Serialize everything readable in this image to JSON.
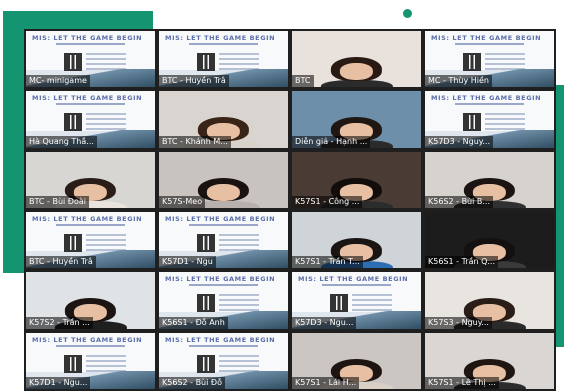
{
  "slide_title": "MIS: LET THE GAME BEGIN",
  "colors": {
    "accent": "#159472",
    "active_speaker": "#9ad24a"
  },
  "participants": [
    {
      "label": "MC- minigame",
      "kind": "slide"
    },
    {
      "label": "BTC - Huyền Trâ",
      "kind": "slide"
    },
    {
      "label": "BTC",
      "kind": "cam",
      "bg": "#e9e1dc",
      "hair": "#2a1a14",
      "body": "#2b2b2b"
    },
    {
      "label": "MC - Thùy Hiền",
      "kind": "slide"
    },
    {
      "label": "Hà Quang Thắ...",
      "kind": "slide"
    },
    {
      "label": "BTC - Khánh M...",
      "kind": "cam",
      "bg": "#d9d4d0",
      "hair": "#3a2418",
      "body": "#d9d2ca"
    },
    {
      "label": "Diễn giả - Hạnh ...",
      "kind": "cam",
      "bg": "#6d8fa9",
      "hair": "#201612",
      "body": "#2b2b2b",
      "speaking": true
    },
    {
      "label": "K57D3 - Nguy...",
      "kind": "slide"
    },
    {
      "label": "BTC - Bùi Đoài",
      "kind": "cam",
      "bg": "#d8d6d2",
      "hair": "#2a1d17",
      "body": "#e8e3dd"
    },
    {
      "label": "K57S-Meo",
      "kind": "cam",
      "bg": "#c9c3bf",
      "hair": "#1a1210",
      "body": "#b8b0ad"
    },
    {
      "label": "K57S1 - Công ...",
      "kind": "cam",
      "bg": "#4a3b34",
      "hair": "#120c0a",
      "body": "#2c2c2c"
    },
    {
      "label": "K56S2 - Bùi B...",
      "kind": "cam",
      "bg": "#d6d3cf",
      "hair": "#1c1412",
      "body": "#303030"
    },
    {
      "label": "BTC - Huyền Trâ",
      "kind": "slide"
    },
    {
      "label": "K57D1 - Ngu",
      "kind": "slide"
    },
    {
      "label": "K57S1 - Trần T...",
      "kind": "cam",
      "bg": "#cfd4d8",
      "hair": "#1a1412",
      "body": "#2d6db3"
    },
    {
      "label": "K56S1 - Trần Q...",
      "kind": "cam",
      "bg": "#1c1c1c",
      "hair": "#151010",
      "body": "#3a3a3a"
    },
    {
      "label": "K57S2 - Trần ...",
      "kind": "cam",
      "bg": "#dfe3e6",
      "hair": "#1c1412",
      "body": "#1f1f1f"
    },
    {
      "label": "K56S1 - Đỗ Anh",
      "kind": "slide"
    },
    {
      "label": "K57D3 - Ngu...",
      "kind": "slide"
    },
    {
      "label": "K57S3 - Nguy...",
      "kind": "cam",
      "bg": "#e8e4e0",
      "hair": "#2a1c16",
      "body": "#2a2a2a"
    },
    {
      "label": "K57D1 - Ngu...",
      "kind": "slide"
    },
    {
      "label": "K56S2 - Bùi Đỗ",
      "kind": "slide"
    },
    {
      "label": "K57S1 - Lái H...",
      "kind": "cam",
      "bg": "#cbc6c2",
      "hair": "#1e1512",
      "body": "#d9d0c6"
    },
    {
      "label": "K57S1 - Lê Thị ...",
      "kind": "cam",
      "bg": "#d9d6d3",
      "hair": "#1f1612",
      "body": "#2c2c2c"
    }
  ]
}
